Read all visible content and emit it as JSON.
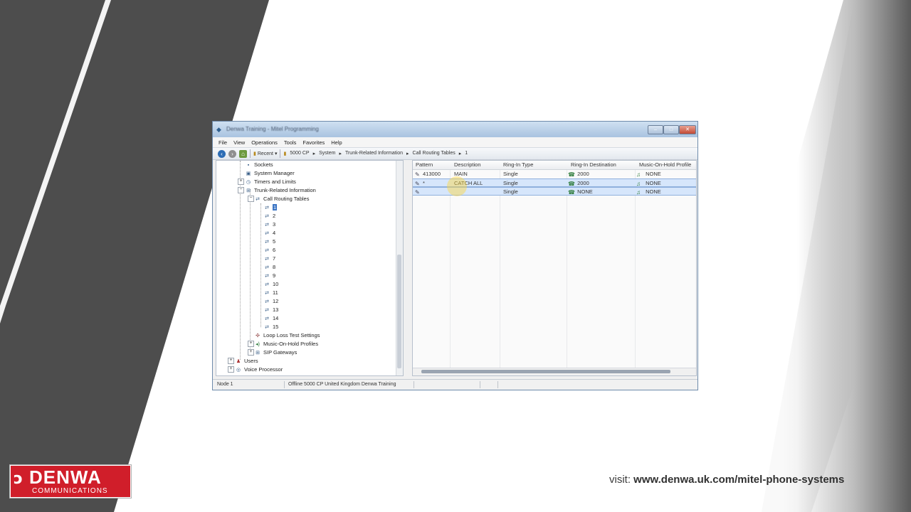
{
  "window": {
    "title": "Denwa Training - Mitel Programming",
    "min_label": "–",
    "max_label": "□",
    "close_label": "✕"
  },
  "menu": [
    "File",
    "View",
    "Operations",
    "Tools",
    "Favorites",
    "Help"
  ],
  "toolbar": {
    "recent_label": "Recent",
    "breadcrumb": [
      "5000 CP",
      "System",
      "Trunk-Related Information",
      "Call Routing Tables",
      "1"
    ]
  },
  "tree": {
    "items": [
      {
        "label": "Sockets"
      },
      {
        "label": "System Manager"
      },
      {
        "label": "Timers and Limits"
      },
      {
        "label": "Trunk-Related Information"
      },
      {
        "label": "Call Routing Tables"
      },
      {
        "label": "1"
      },
      {
        "label": "2"
      },
      {
        "label": "3"
      },
      {
        "label": "4"
      },
      {
        "label": "5"
      },
      {
        "label": "6"
      },
      {
        "label": "7"
      },
      {
        "label": "8"
      },
      {
        "label": "9"
      },
      {
        "label": "10"
      },
      {
        "label": "11"
      },
      {
        "label": "12"
      },
      {
        "label": "13"
      },
      {
        "label": "14"
      },
      {
        "label": "15"
      },
      {
        "label": "Loop Loss Test Settings"
      },
      {
        "label": "Music-On-Hold Profiles"
      },
      {
        "label": "SIP Gateways"
      },
      {
        "label": "Users"
      },
      {
        "label": "Voice Processor"
      }
    ]
  },
  "grid": {
    "columns": [
      "Pattern",
      "Description",
      "Ring-In Type",
      "Ring-In Destination",
      "Music-On-Hold Profile"
    ],
    "rows": [
      [
        "413000",
        "MAIN",
        "Single",
        "2000",
        "NONE"
      ],
      [
        "*",
        "CATCH ALL",
        "Single",
        "2000",
        "NONE"
      ],
      [
        "",
        "",
        "Single",
        "NONE",
        "NONE"
      ]
    ]
  },
  "status": {
    "node": "Node 1",
    "connection": "Offline 5000 CP United Kingdom Denwa Training"
  },
  "logo": {
    "name": "DENWA",
    "subtitle": "COMMUNICATIONS"
  },
  "footer": {
    "visit_prefix": "visit: ",
    "url": "www.denwa.uk.com/mitel-phone-systems"
  }
}
